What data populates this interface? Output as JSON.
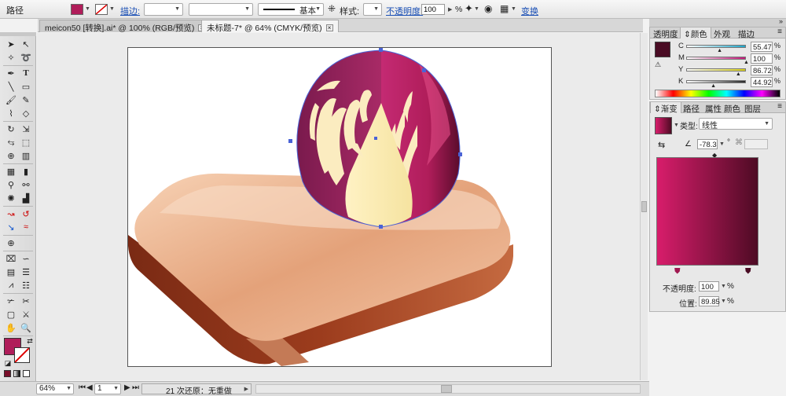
{
  "control_bar": {
    "object_type": "路径",
    "fill_color": "#b01d5a",
    "stroke_label": "描边:",
    "brush_value": "基本",
    "style_label": "样式:",
    "opacity_label": "不透明度:",
    "opacity_value": "100",
    "opacity_unit": "%",
    "transform_label": "变换"
  },
  "tabs": [
    {
      "label": "meicon50 [转换].ai* @ 100% (RGB/预览)",
      "active": false
    },
    {
      "label": "未标题-7* @ 64% (CMYK/预览)",
      "active": true
    }
  ],
  "status_bar": {
    "zoom": "64%",
    "page": "1",
    "undo_text": "21 次还原：无重做"
  },
  "color_panel": {
    "tabs": [
      "透明度",
      "颜色",
      "外观",
      "描边"
    ],
    "active_tab": "颜色",
    "swatch": "#4a0c24",
    "channels": [
      {
        "name": "C",
        "value": "55.47",
        "color": "#1fa6c9"
      },
      {
        "name": "M",
        "value": "100",
        "color": "#c4167a"
      },
      {
        "name": "Y",
        "value": "86.72",
        "color": "#d8cf16"
      },
      {
        "name": "K",
        "value": "44.92",
        "color": "#2a2a2a"
      }
    ]
  },
  "gradient_panel": {
    "tabs": [
      "渐变",
      "路径",
      "属性",
      "颜色",
      "图层"
    ],
    "active_tab": "渐变",
    "type_label": "类型:",
    "type_value": "线性",
    "angle_value": "-78.3",
    "angle_unit": "°",
    "start_color": "#d81d6b",
    "end_color": "#4e0b24",
    "opacity_label": "不透明度:",
    "opacity_value": "100",
    "opacity_unit": "%",
    "position_label": "位置:",
    "position_value": "89.85",
    "position_unit": "%"
  },
  "toolbox": {
    "fill_color": "#b01d5a"
  }
}
